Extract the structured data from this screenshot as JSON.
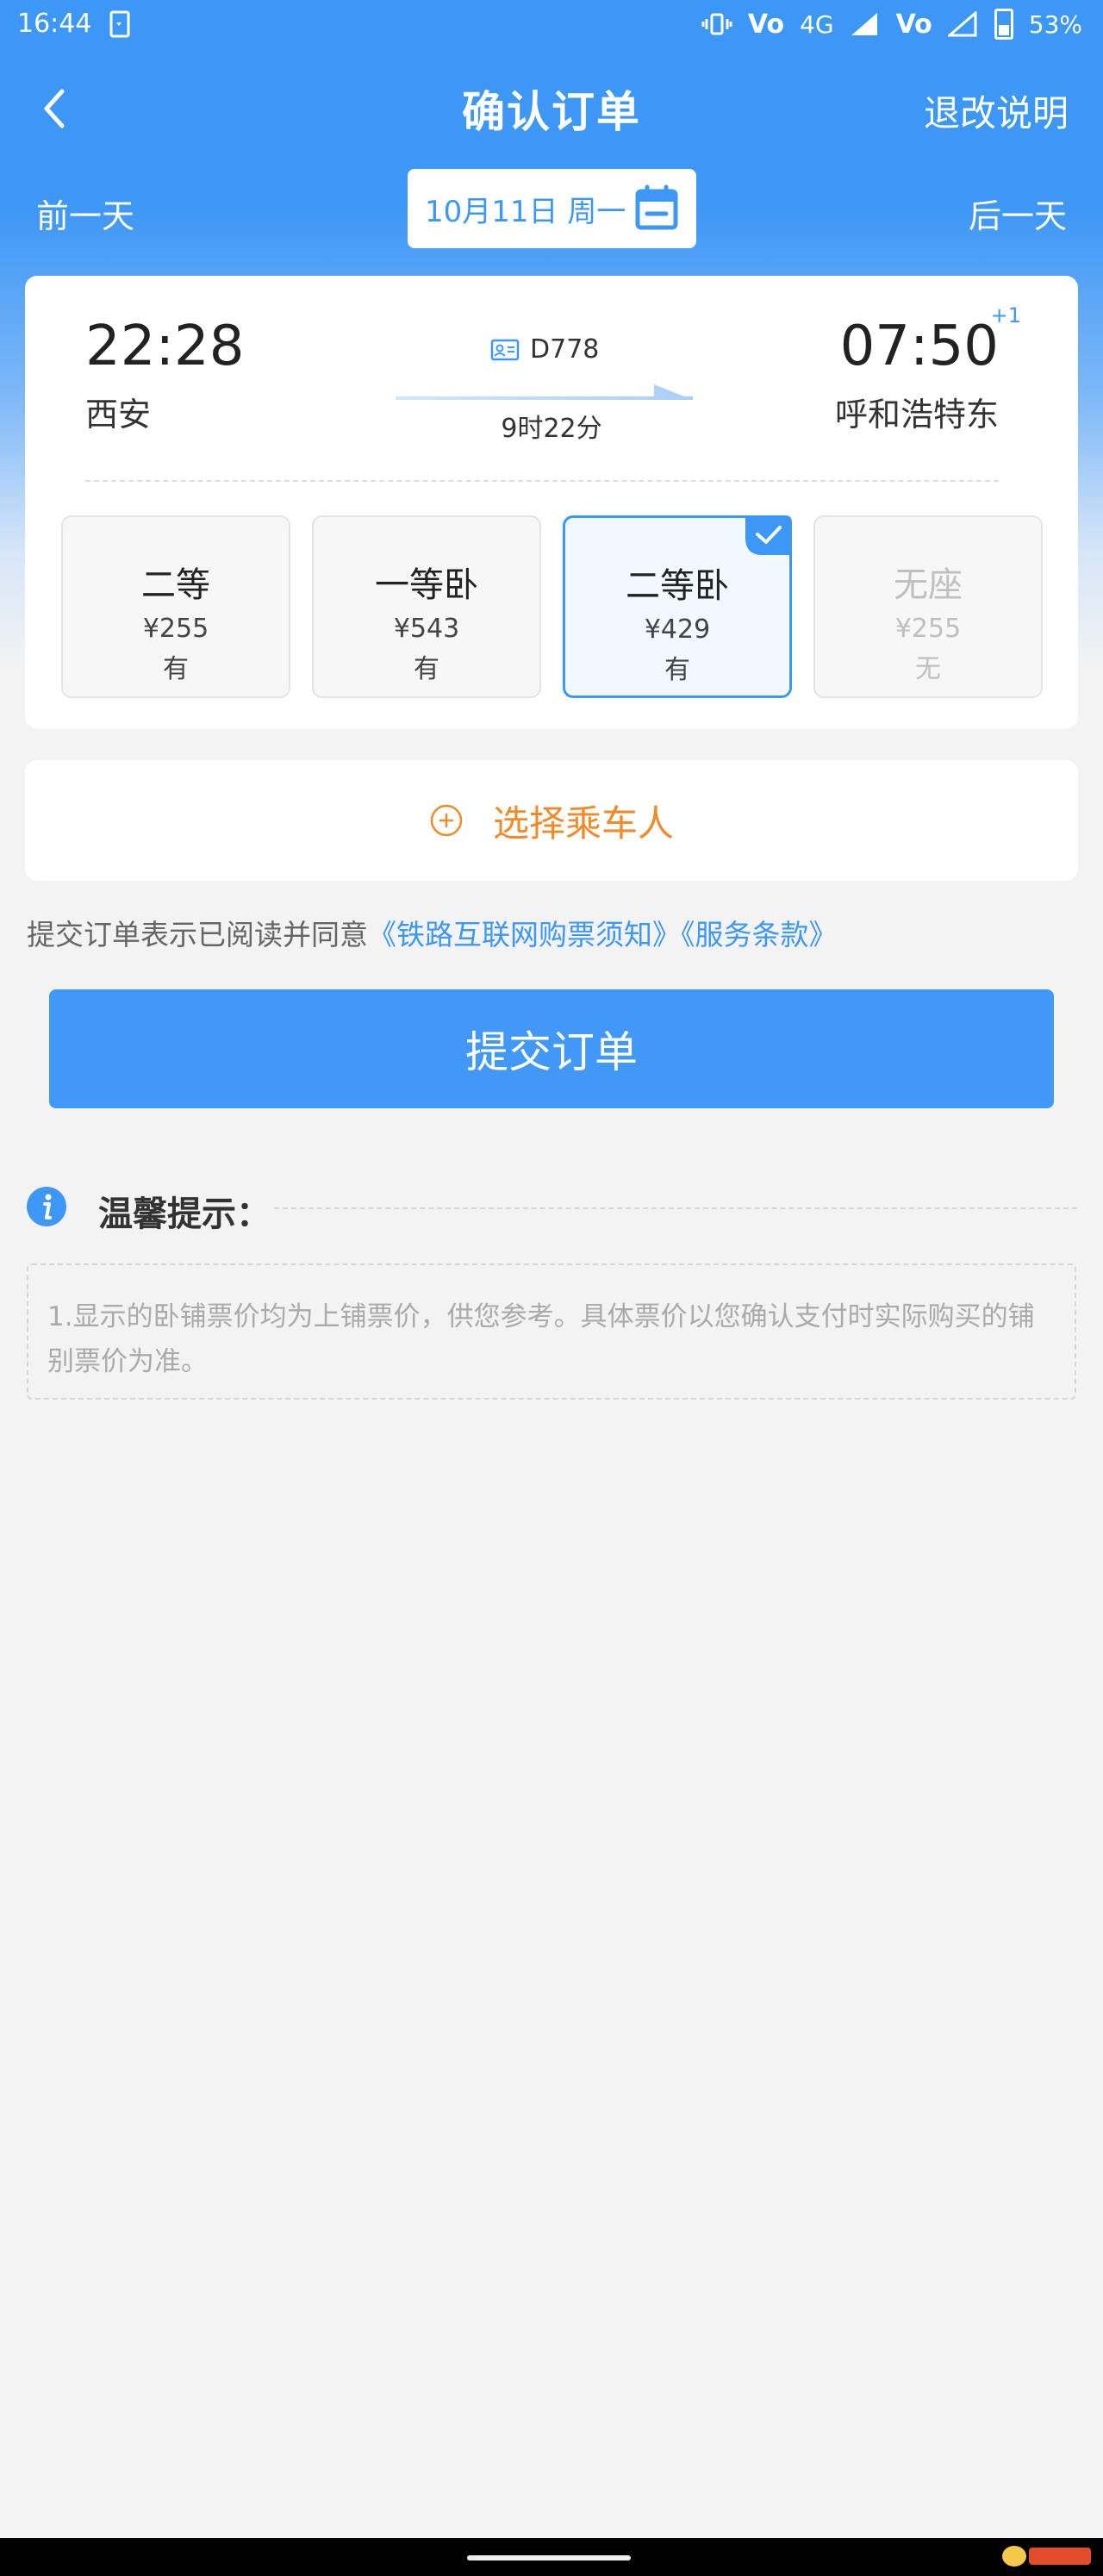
{
  "status_bar": {
    "time": "16:44",
    "network": "4G",
    "volte": "Vo",
    "battery": "53%"
  },
  "nav": {
    "title": "确认订单",
    "right_link": "退改说明"
  },
  "date_bar": {
    "prev": "前一天",
    "date": "10月11日 周一",
    "next": "后一天"
  },
  "train": {
    "depart_time": "22:28",
    "depart_station": "西安",
    "train_no": "D778",
    "duration": "9时22分",
    "arrive_time": "07:50",
    "arrive_day_offset": "+1",
    "arrive_station": "呼和浩特东",
    "seats": [
      {
        "name": "二等",
        "price": "¥255",
        "availability": "有",
        "selected": false,
        "disabled": false
      },
      {
        "name": "一等卧",
        "price": "¥543",
        "availability": "有",
        "selected": false,
        "disabled": false
      },
      {
        "name": "二等卧",
        "price": "¥429",
        "availability": "有",
        "selected": true,
        "disabled": false
      },
      {
        "name": "无座",
        "price": "¥255",
        "availability": "无",
        "selected": false,
        "disabled": true
      }
    ]
  },
  "passenger": {
    "label": "选择乘车人"
  },
  "agreement": {
    "prefix": "提交订单表示已阅读并同意",
    "link1": "《铁路互联网购票须知》",
    "link2": "《服务条款》"
  },
  "submit_label": "提交订单",
  "tips": {
    "title": "温馨提示：",
    "content": "1.显示的卧铺票价均为上铺票价，供您参考。具体票价以您确认支付时实际购买的铺别票价为准。"
  },
  "colors": {
    "primary": "#3d97f5",
    "accent_orange": "#f08a2b",
    "background": "#f3f3f3"
  }
}
